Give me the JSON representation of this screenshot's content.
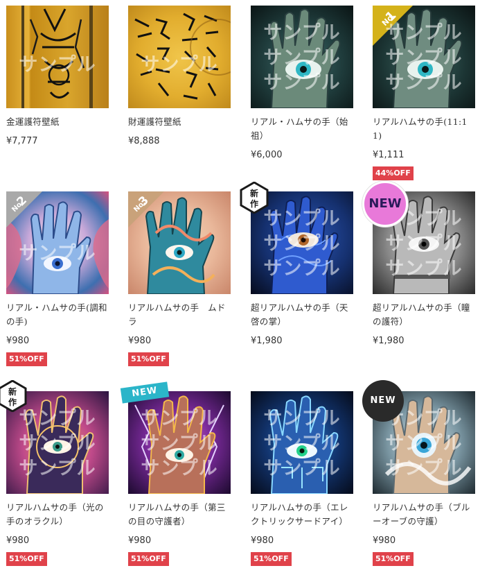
{
  "watermark": "サンプル",
  "products": [
    {
      "name": "金運護符壁紙",
      "price": "¥7,777",
      "off": "",
      "badge": ""
    },
    {
      "name": "財運護符壁紙",
      "price": "¥8,888",
      "off": "",
      "badge": ""
    },
    {
      "name": "リアル・ハムサの手（始祖）",
      "price": "¥6,000",
      "off": "",
      "badge": ""
    },
    {
      "name": "リアルハムサの手(11:11)",
      "price": "¥1,111",
      "off": "44%OFF",
      "badge": "No.1"
    },
    {
      "name": "リアル・ハムサの手(調和の手)",
      "price": "¥980",
      "off": "51%OFF",
      "badge": "No.2"
    },
    {
      "name": "リアルハムサの手　ムドラ",
      "price": "¥980",
      "off": "51%OFF",
      "badge": "No.3"
    },
    {
      "name": "超リアルハムサの手（天啓の掌）",
      "price": "¥1,980",
      "off": "",
      "badge": "新作"
    },
    {
      "name": "超リアルハムサの手（瞳の護符）",
      "price": "¥1,980",
      "off": "",
      "badge": "NEW"
    },
    {
      "name": "リアルハムサの手（光の手のオラクル）",
      "price": "¥980",
      "off": "51%OFF",
      "badge": "新作"
    },
    {
      "name": "リアルハムサの手（第三の目の守護者）",
      "price": "¥980",
      "off": "51%OFF",
      "badge": "NEW"
    },
    {
      "name": "リアルハムサの手（エレクトリックサードアイ）",
      "price": "¥980",
      "off": "51%OFF",
      "badge": ""
    },
    {
      "name": "リアルハムサの手（ブルーオーブの守護）",
      "price": "¥980",
      "off": "51%OFF",
      "badge": "NEW"
    }
  ],
  "colors": {
    "off_badge": "#e0424a",
    "gold_badge": "#d4b21a",
    "gray_badge": "#a9a9a9",
    "tan_badge": "#c9a27a",
    "teal_ribbon": "#2bb5c9",
    "pink_new": "#e879d9",
    "dark_new": "#2a2a2a"
  }
}
